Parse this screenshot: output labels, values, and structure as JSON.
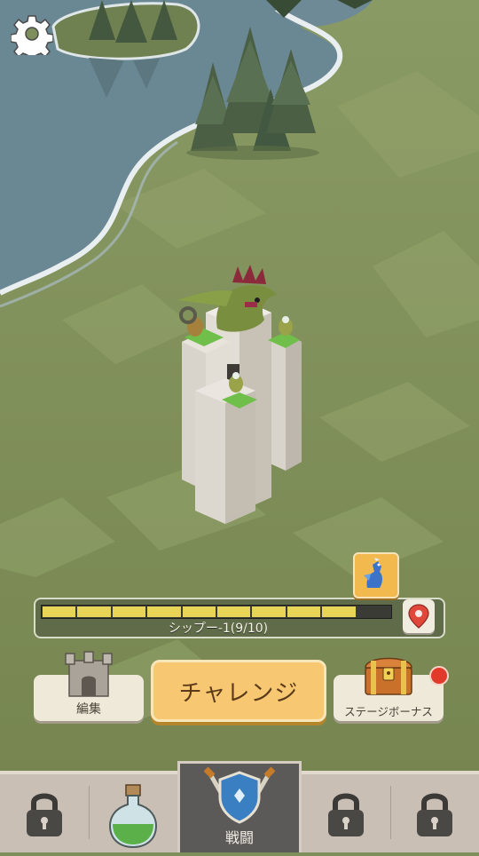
{
  "hud": {
    "settings_icon": "gear-icon"
  },
  "stage": {
    "label": "シップー-1(9/10)",
    "segments_total": 10,
    "segments_filled": 9,
    "boss_icon": "blue-dragon-icon",
    "location_icon": "map-pin-icon"
  },
  "actions": {
    "edit_label": "編集",
    "challenge_label": "チャレンジ",
    "bonus_label": "ステージボーナス"
  },
  "nav": {
    "items": [
      {
        "name": "locked-1",
        "icon": "lock-icon"
      },
      {
        "name": "potion",
        "icon": "potion-icon"
      },
      {
        "name": "battle",
        "icon": "shield-swords-icon",
        "label": "戦闘"
      },
      {
        "name": "locked-2",
        "icon": "lock-icon"
      },
      {
        "name": "locked-3",
        "icon": "lock-icon"
      }
    ]
  },
  "colors": {
    "bar_fill": "#e8d456",
    "challenge": "#f7c871",
    "nav_bg": "#c9bfb5",
    "alert": "#e23a2a"
  }
}
